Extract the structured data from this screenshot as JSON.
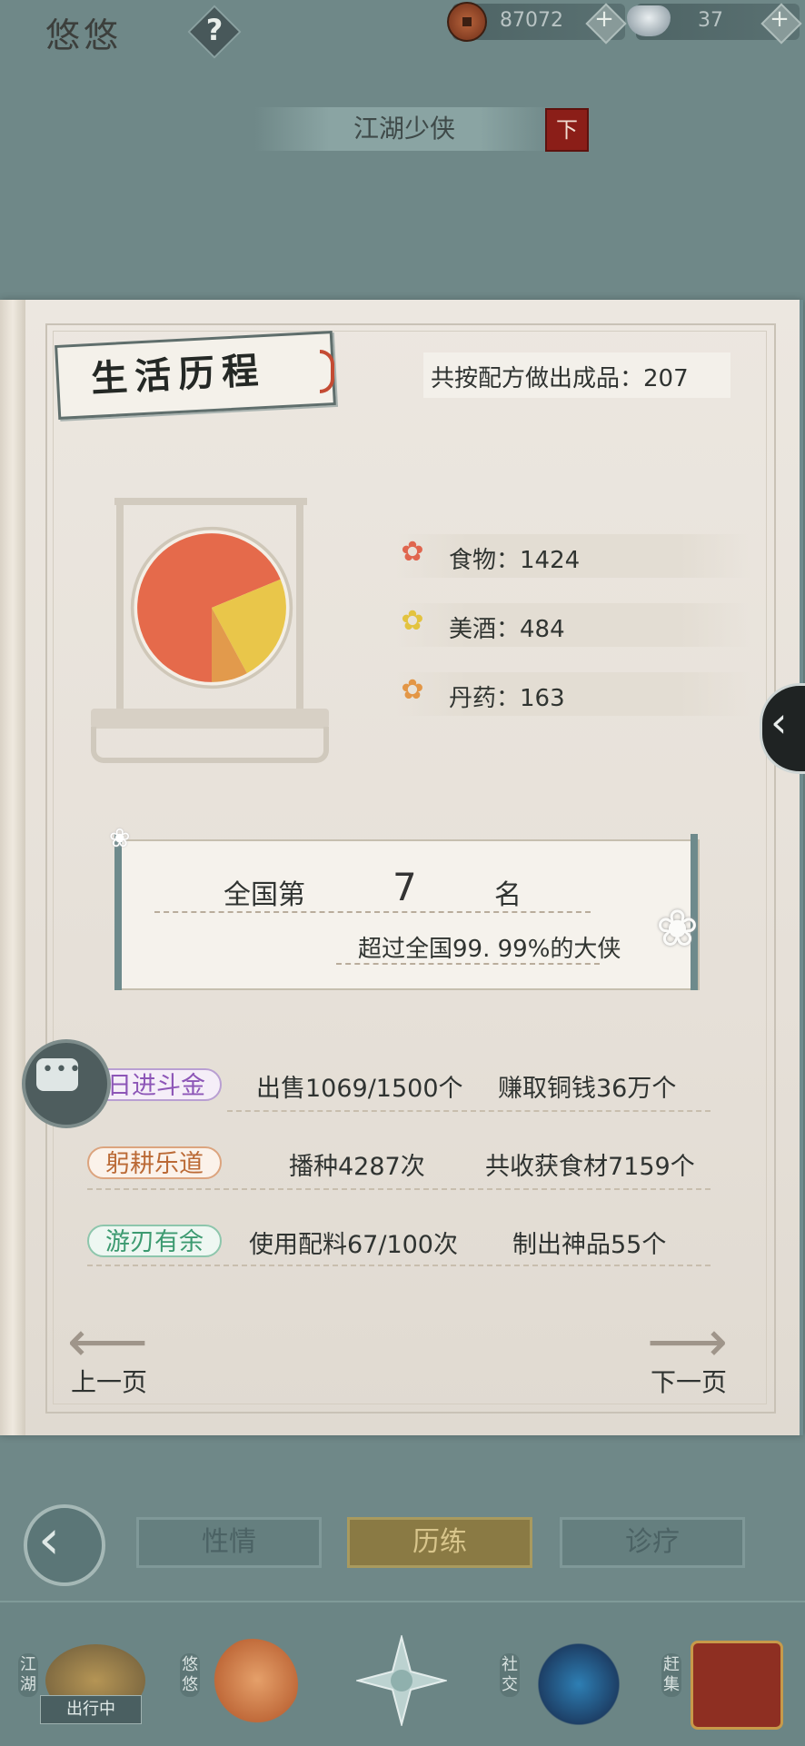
{
  "header": {
    "char_name": "悠悠",
    "help": "?",
    "copper": "87072",
    "ingots": "37",
    "plus": "+"
  },
  "title": {
    "text": "江湖少侠",
    "seal": "下"
  },
  "section": {
    "title": "生活历程",
    "total_label": "共按配方做出成品：207"
  },
  "chart_data": {
    "type": "pie",
    "categories": [
      "食物",
      "美酒",
      "丹药"
    ],
    "values": [
      1424,
      484,
      163
    ],
    "colors": [
      "#e56a4b",
      "#e9c64a",
      "#e29a4c"
    ]
  },
  "legend": [
    {
      "label": "食物：1424",
      "color": "#e0664f"
    },
    {
      "label": "美酒：484",
      "color": "#e3c33f"
    },
    {
      "label": "丹药：163",
      "color": "#e39646"
    }
  ],
  "rank": {
    "prefix": "全国第",
    "number": "7",
    "suffix": "名",
    "subtext": "超过全国99. 99%的大侠"
  },
  "stats": [
    {
      "tag": "日进斗金",
      "a": "出售1069/1500个",
      "b": "赚取铜钱36万个"
    },
    {
      "tag": "躬耕乐道",
      "a": "播种4287次",
      "b": "共收获食材7159个"
    },
    {
      "tag": "游刃有余",
      "a": "使用配料67/100次",
      "b": "制出神品55个"
    }
  ],
  "pager": {
    "prev": "上一页",
    "next": "下一页"
  },
  "tabs": [
    {
      "label": "性情"
    },
    {
      "label": "历练"
    },
    {
      "label": "诊疗"
    }
  ],
  "nav": [
    {
      "label": "江湖",
      "status": "出行中"
    },
    {
      "label": "悠悠"
    },
    {
      "label": "社交"
    },
    {
      "label": "赶集"
    }
  ]
}
